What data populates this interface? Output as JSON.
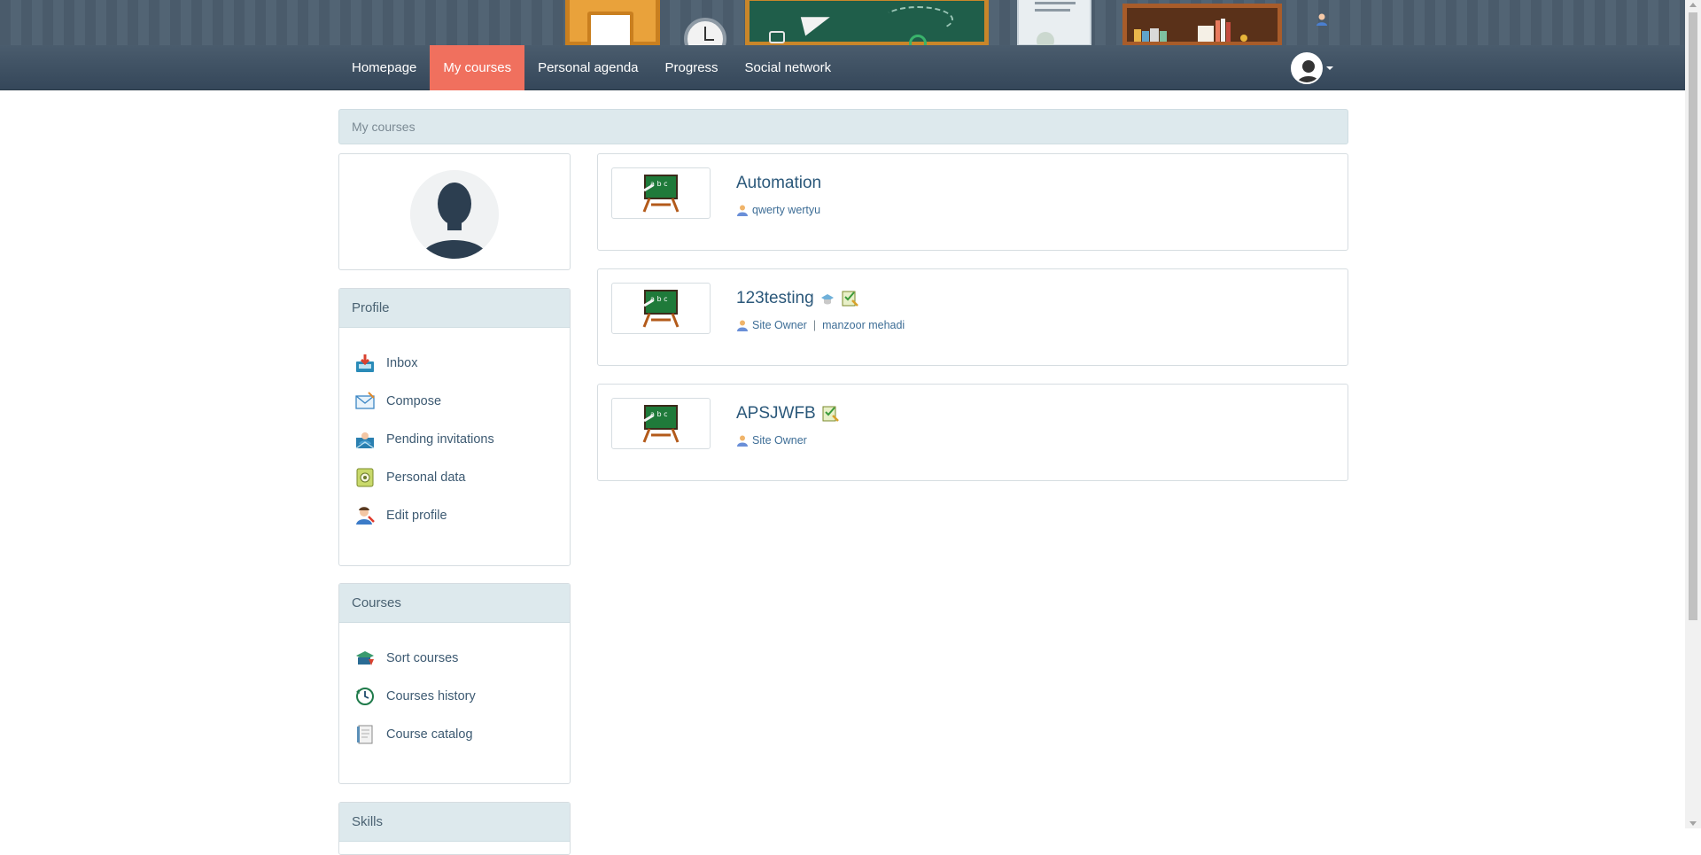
{
  "nav": {
    "items": [
      {
        "label": "Homepage",
        "active": false
      },
      {
        "label": "My courses",
        "active": true
      },
      {
        "label": "Personal agenda",
        "active": false
      },
      {
        "label": "Progress",
        "active": false
      },
      {
        "label": "Social network",
        "active": false
      }
    ],
    "active_color": "#f0705e"
  },
  "breadcrumb": {
    "label": "My courses"
  },
  "profile_panel": {
    "title": "Profile",
    "items": [
      {
        "label": "Inbox",
        "icon": "inbox-icon"
      },
      {
        "label": "Compose",
        "icon": "envelope-icon"
      },
      {
        "label": "Pending invitations",
        "icon": "invitation-icon"
      },
      {
        "label": "Personal data",
        "icon": "personal-data-icon"
      },
      {
        "label": "Edit profile",
        "icon": "edit-profile-icon"
      }
    ]
  },
  "courses_panel": {
    "title": "Courses",
    "items": [
      {
        "label": "Sort courses",
        "icon": "sort-courses-icon"
      },
      {
        "label": "Courses history",
        "icon": "history-icon"
      },
      {
        "label": "Course catalog",
        "icon": "catalog-icon"
      }
    ]
  },
  "skills_panel": {
    "title": "Skills"
  },
  "courses": [
    {
      "title": "Automation",
      "teachers": [
        "qwerty wertyu"
      ]
    },
    {
      "title": "123testing",
      "teachers": [
        "Site Owner",
        "manzoor mehadi"
      ]
    },
    {
      "title": "APSJWFB",
      "teachers": [
        "Site Owner"
      ]
    }
  ],
  "teacher_separator": "|"
}
